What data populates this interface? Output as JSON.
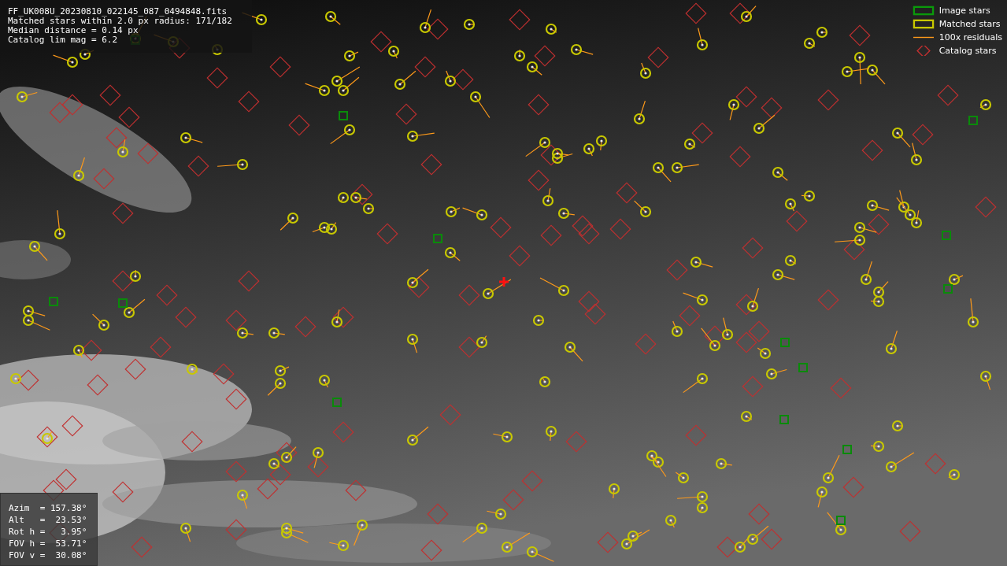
{
  "info_box": {
    "lines": [
      "FF_UK008U_20230810_022145_087_0494848.fits",
      "Matched stars within 2.0 px radius: 171/182",
      "Median distance = 0.14 px",
      "Catalog lim mag = 6.2"
    ]
  },
  "legend": [
    {
      "label": "Image stars"
    },
    {
      "label": "Matched stars",
      "kind": "matched"
    },
    {
      "label": "100x residuals",
      "kind": "residual"
    },
    {
      "label": "Catalog stars",
      "kind": "catalog"
    }
  ],
  "pointing_box": {
    "lines": [
      "Azim  = 157.38°",
      "Alt   =  23.53°",
      "Rot h =   3.95°",
      "FOV h =  53.71°",
      "FOV v =  30.08°"
    ]
  }
}
